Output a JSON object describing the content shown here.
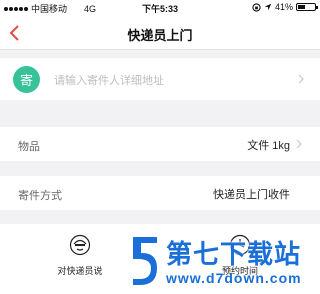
{
  "status_bar": {
    "carrier": "中国移动",
    "network": "4G",
    "time": "下午5:33",
    "battery": "41%",
    "battery_level": 0.41
  },
  "nav": {
    "title": "快递员上门",
    "back_icon": "chevron-left-icon"
  },
  "sender": {
    "badge": "寄",
    "badge_color": "#37c39a",
    "address_placeholder": "请输入寄件人详细地址"
  },
  "item": {
    "label": "物品",
    "value": "文件 1kg"
  },
  "method": {
    "label": "寄件方式",
    "value": "快递员上门收件"
  },
  "actions": [
    {
      "label": "对快递员说",
      "icon": "courier-icon"
    },
    {
      "label": "预约时间",
      "icon": "clock-icon"
    }
  ],
  "watermark": {
    "name": "第七下载站",
    "url": "www.d7down.com",
    "color": "#1a6fd8"
  },
  "colors": {
    "accent": "#e94b4b",
    "background": "#f2f2f4"
  }
}
